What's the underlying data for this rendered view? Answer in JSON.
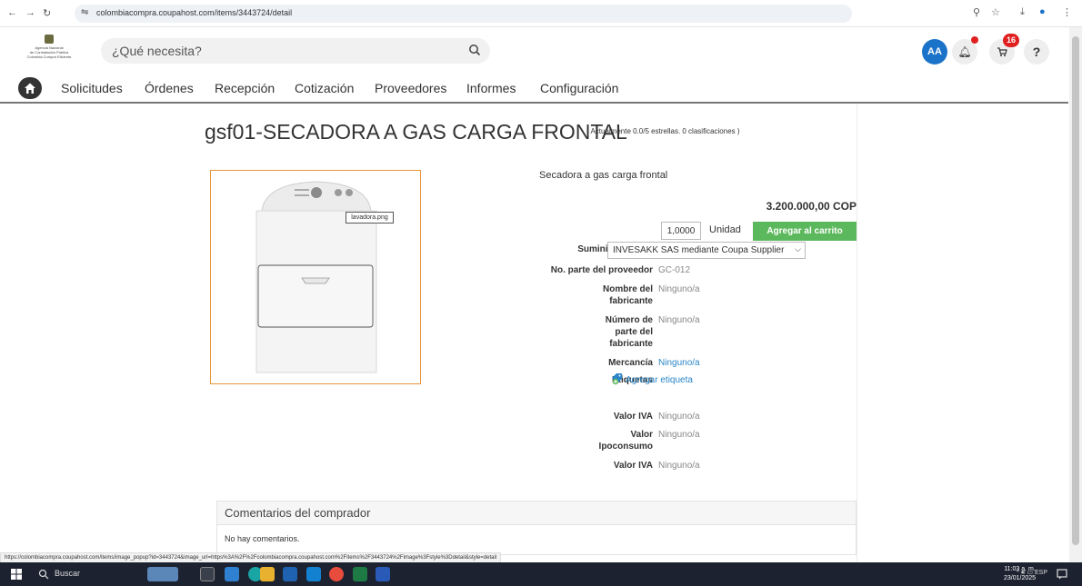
{
  "browser": {
    "url": "colombiacompra.coupahost.com/items/3443724/detail",
    "status_url": "https://colombiacompra.coupahost.com/items/image_popup?id=3443724&image_url=https%3A%2F%2Fcolombiacompra.coupahost.com%2Fitems%2F3443724%2Fimage%3Fstyle%3Ddetail&style=detail"
  },
  "header": {
    "logo_lines": [
      "Agencia Nacional",
      "de Contratación Pública",
      "Colombia Compra Eficiente"
    ],
    "search_placeholder": "¿Qué necesita?",
    "avatar": "AA",
    "cart_count": "16",
    "help": "?"
  },
  "menu": {
    "items": [
      "Solicitudes",
      "Órdenes",
      "Recepción",
      "Cotización",
      "Proveedores",
      "Informes",
      "Configuración"
    ]
  },
  "item": {
    "title": "gsf01-SECADORA A GAS CARGA FRONTAL",
    "rating": "( Actualmente 0.0/5 estrellas. 0 clasificaciones )",
    "image_tooltip": "lavadora.png",
    "description": "Secadora a gas carga frontal",
    "price": "3.200.000,00 COP",
    "quantity": "1,0000",
    "unit": "Unidad",
    "add_to_cart": "Agregar al carrito",
    "fields": {
      "supplied_by_label": "Suministrado por",
      "supplied_by_value": "INVESAKK SAS mediante Coupa Supplier",
      "supplier_part_label": "No. parte del proveedor",
      "supplier_part_value": "GC-012",
      "manufacturer_name_label": "Nombre del fabricante",
      "manufacturer_name_value": "Ninguno/a",
      "manufacturer_part_label": "Número de parte del fabricante",
      "manufacturer_part_value": "Ninguno/a",
      "commodity_label": "Mercancía",
      "commodity_value": "Ninguno/a",
      "tags_label": "Etiquetas",
      "tags_value": "Agregar etiqueta",
      "iva_label": "Valor IVA",
      "iva_value": "Ninguno/a",
      "ipoconsumo_label": "Valor Ipoconsumo",
      "ipoconsumo_value": "Ninguno/a",
      "iva2_label": "Valor IVA",
      "iva2_value": "Ninguno/a"
    }
  },
  "comments": {
    "title": "Comentarios del comprador",
    "empty": "No hay comentarios."
  },
  "taskbar": {
    "search": "Buscar",
    "lang": "ESP",
    "time": "11:03 a. m.",
    "date": "23/01/2025"
  }
}
